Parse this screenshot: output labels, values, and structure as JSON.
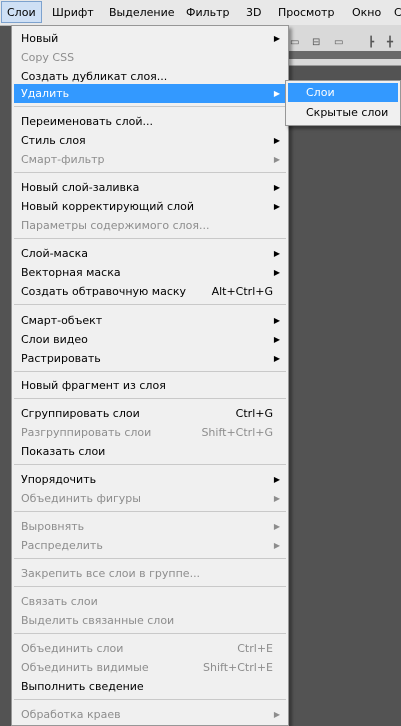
{
  "menubar": {
    "items": [
      "Слои",
      "Шрифт",
      "Выделение",
      "Фильтр",
      "3D",
      "Просмотр",
      "Окно",
      "С"
    ]
  },
  "menu": {
    "items": [
      {
        "label": "Новый",
        "submenu": true
      },
      {
        "label": "Copy CSS",
        "disabled": true
      },
      {
        "label": "Создать дубликат слоя..."
      },
      {
        "label": "Удалить",
        "submenu": true,
        "highlighted": true
      },
      {
        "label": "Переименовать слой..."
      },
      {
        "label": "Стиль слоя",
        "submenu": true
      },
      {
        "label": "Смарт-фильтр",
        "submenu": true,
        "disabled": true
      },
      {
        "label": "Новый слой-заливка",
        "submenu": true
      },
      {
        "label": "Новый корректирующий слой",
        "submenu": true
      },
      {
        "label": "Параметры содержимого слоя...",
        "disabled": true
      },
      {
        "label": "Слой-маска",
        "submenu": true
      },
      {
        "label": "Векторная маска",
        "submenu": true
      },
      {
        "label": "Создать обтравочную маску",
        "shortcut": "Alt+Ctrl+G"
      },
      {
        "label": "Смарт-объект",
        "submenu": true
      },
      {
        "label": "Слои видео",
        "submenu": true
      },
      {
        "label": "Растрировать",
        "submenu": true
      },
      {
        "label": "Новый фрагмент из слоя"
      },
      {
        "label": "Сгруппировать слои",
        "shortcut": "Ctrl+G"
      },
      {
        "label": "Разгруппировать слои",
        "shortcut": "Shift+Ctrl+G",
        "disabled": true
      },
      {
        "label": "Показать слои"
      },
      {
        "label": "Упорядочить",
        "submenu": true
      },
      {
        "label": "Объединить фигуры",
        "submenu": true,
        "disabled": true
      },
      {
        "label": "Выровнять",
        "submenu": true,
        "disabled": true
      },
      {
        "label": "Распределить",
        "submenu": true,
        "disabled": true
      },
      {
        "label": "Закрепить все слои в группе...",
        "disabled": true
      },
      {
        "label": "Связать слои",
        "disabled": true
      },
      {
        "label": "Выделить связанные слои",
        "disabled": true
      },
      {
        "label": "Объединить слои",
        "shortcut": "Ctrl+E",
        "disabled": true
      },
      {
        "label": "Объединить видимые",
        "shortcut": "Shift+Ctrl+E",
        "disabled": true
      },
      {
        "label": "Выполнить сведение"
      },
      {
        "label": "Обработка краев",
        "submenu": true,
        "disabled": true
      }
    ]
  },
  "submenu": {
    "items": [
      {
        "label": "Слои",
        "highlighted": true
      },
      {
        "label": "Скрытые слои"
      }
    ]
  },
  "colors": {
    "highlight": "#3399ff",
    "disabled_text": "#8d8d8d",
    "menu_bg": "#f0f0f0"
  }
}
